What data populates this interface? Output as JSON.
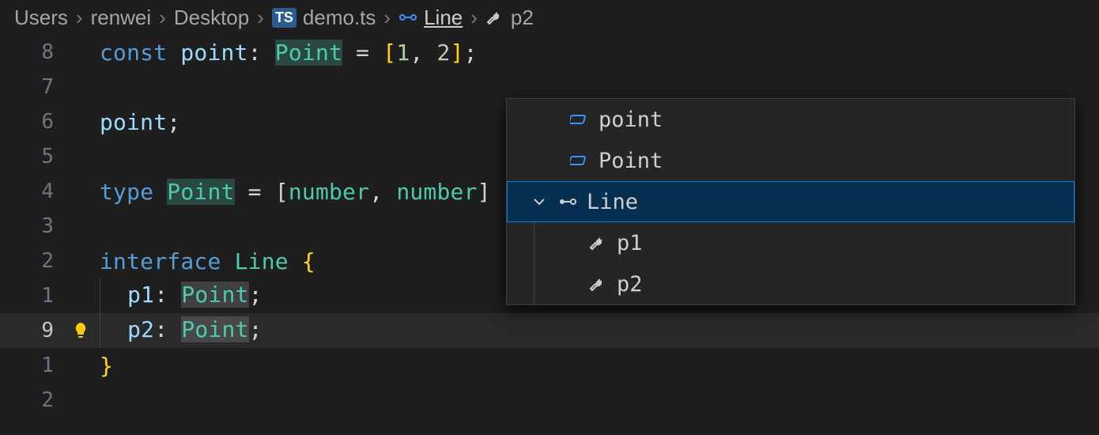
{
  "breadcrumb": {
    "users": "Users",
    "renwei": "renwei",
    "desktop": "Desktop",
    "ts_badge": "TS",
    "file": "demo.ts",
    "symbol1": "Line",
    "symbol2": "p2"
  },
  "gutters": {
    "l1": "8",
    "l2": "7",
    "l3": "6",
    "l4": "5",
    "l5": "4",
    "l6": "3",
    "l7": "2",
    "l8": "1",
    "l9": "9",
    "l10": "1",
    "l11": "2"
  },
  "code": {
    "l1_const": "const ",
    "l1_point": "point",
    "l1_colon": ": ",
    "l1_Point": "Point",
    "l1_eq": " = ",
    "l1_br_o": "[",
    "l1_1": "1",
    "l1_c": ", ",
    "l1_2": "2",
    "l1_br_c": "]",
    "l1_semi": ";",
    "l3_point": "point",
    "l3_semi": ";",
    "l5_type": "type ",
    "l5_Point": "Point",
    "l5_eq": " = [",
    "l5_num1": "number",
    "l5_c": ", ",
    "l5_num2": "number",
    "l5_close": "]",
    "l7_interface": "interface ",
    "l7_Line": "Line",
    "l7_sp": " ",
    "l7_brace": "{",
    "l8_p1": "p1",
    "l8_colon": ": ",
    "l8_Point": "Point",
    "l8_semi": ";",
    "l9_p2": "p2",
    "l9_colon": ": ",
    "l9_Point": "Point",
    "l9_semi": ";",
    "l10_brace": "}"
  },
  "outline": {
    "point_var": "point",
    "point_type": "Point",
    "line": "Line",
    "p1": "p1",
    "p2": "p2"
  }
}
